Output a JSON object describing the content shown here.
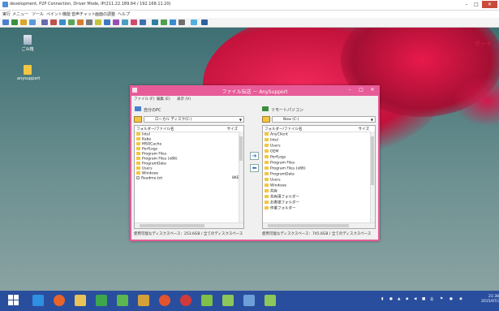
{
  "window": {
    "title": "development, P2P Connection, Driver Mode, IP(211.22.189.64 / 192.168.11.20)",
    "minimize": "–",
    "maximize": "□",
    "close": "✕"
  },
  "menu": [
    "実行",
    "メニュー",
    "ツール",
    "ペイント機能",
    "音声チャット",
    "画面の調整",
    "ヘルプ"
  ],
  "desktop": {
    "icons": [
      {
        "label": "ごみ箱"
      },
      {
        "label": "anysupport"
      }
    ],
    "overlay_text": "ポート"
  },
  "dialog": {
    "title": "ファイル伝送 － AnySupport",
    "menu": [
      "ファイル (F)",
      "編集 (E)",
      "表示 (V)"
    ],
    "local": {
      "heading": "自分のPC",
      "drive": "ローカル ディスク(C:)",
      "col_name": "フォルダー/ファイル名",
      "col_size": "サイズ",
      "items": [
        {
          "name": "Intel",
          "size": "",
          "type": "folder"
        },
        {
          "name": "Kabe",
          "size": "",
          "type": "folder"
        },
        {
          "name": "MSOCache",
          "size": "",
          "type": "folder"
        },
        {
          "name": "PerfLogs",
          "size": "",
          "type": "folder"
        },
        {
          "name": "Program Files",
          "size": "",
          "type": "folder"
        },
        {
          "name": "Program Files (x86)",
          "size": "",
          "type": "folder"
        },
        {
          "name": "ProgramData",
          "size": "",
          "type": "folder"
        },
        {
          "name": "Users",
          "size": "",
          "type": "folder"
        },
        {
          "name": "Windows",
          "size": "",
          "type": "folder"
        },
        {
          "name": "Readme.txt",
          "size": "8KB",
          "type": "file"
        }
      ],
      "status": "使用可能なディスクスペース：253.6GB / 全てのディスクスペース"
    },
    "remote": {
      "heading": "リモートパソコン",
      "drive": "New (C:)",
      "col_name": "フォルダー/ファイル名",
      "col_size": "サイズ",
      "items": [
        {
          "name": "AnyClient",
          "type": "folder"
        },
        {
          "name": "Intel",
          "type": "folder"
        },
        {
          "name": "Users",
          "type": "folder"
        },
        {
          "name": "OEM",
          "type": "folder"
        },
        {
          "name": "PerfLogs",
          "type": "folder"
        },
        {
          "name": "Program Files",
          "type": "folder"
        },
        {
          "name": "Program Files (x86)",
          "type": "folder"
        },
        {
          "name": "ProgramData",
          "type": "folder"
        },
        {
          "name": "Users",
          "type": "folder"
        },
        {
          "name": "Windows",
          "type": "folder"
        },
        {
          "name": "共有",
          "type": "folder"
        },
        {
          "name": "共有用フォルダー",
          "type": "folder"
        },
        {
          "name": "お客様フォルダー",
          "type": "folder"
        },
        {
          "name": "作業フォルダー",
          "type": "folder"
        }
      ],
      "status": "使用可能なディスクスペース：745.6GB / 全てのディスクスペース"
    },
    "send_arrow": "➔",
    "recv_arrow": "⬅"
  },
  "taskbar": {
    "clock_time": "21:38",
    "clock_date": "2015/07/30"
  },
  "colors": {
    "dialog_accent": "#e75c98",
    "taskbar": "#2a4e9e",
    "close_button": "#c94b3c"
  }
}
